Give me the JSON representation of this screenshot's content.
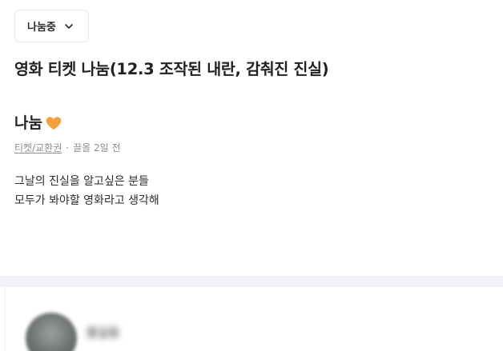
{
  "status": {
    "label": "나눔중",
    "icon": "chevron-down-icon"
  },
  "post": {
    "title": "영화 티켓 나눔(12.3 조작된 내란, 감춰진 진실)",
    "price": "나눔",
    "price_icon": "orange-heart-icon",
    "category": "티켓/교환권",
    "separator": "·",
    "time": "끌올 2일 전",
    "description_lines": [
      "그날의 진실을 알고싶은 분들",
      "모두가 봐야할 영화라고 생각해"
    ]
  },
  "seller": {
    "name": "홍길동"
  },
  "colors": {
    "heart": "#f5a13a",
    "meta_text": "#8b8f94",
    "divider": "#f2f3f6"
  }
}
